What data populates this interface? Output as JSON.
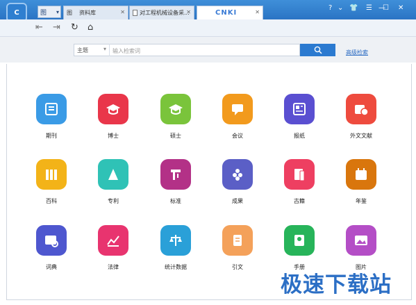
{
  "titlebar": {
    "logo_text": "C",
    "tab_selector": "图",
    "tabs": [
      {
        "label": "资料库"
      },
      {
        "label": "对工程机械设备采..."
      },
      {
        "label": "CNKI"
      }
    ],
    "controls": [
      "?",
      "⌄",
      "—",
      "☐",
      "✕"
    ]
  },
  "search": {
    "field": "主题",
    "placeholder": "输入检索词",
    "advanced": "高级检索"
  },
  "grid": [
    {
      "label": "期刊",
      "color": "#3a9be6",
      "icon": "journal-icon"
    },
    {
      "label": "博士",
      "color": "#e9364a",
      "icon": "doctor-cap-icon"
    },
    {
      "label": "硕士",
      "color": "#7ac43b",
      "icon": "master-cap-icon"
    },
    {
      "label": "会议",
      "color": "#f29a1d",
      "icon": "meeting-icon"
    },
    {
      "label": "报纸",
      "color": "#5a4fd1",
      "icon": "newspaper-icon"
    },
    {
      "label": "外文文献",
      "color": "#ee4b3e",
      "icon": "foreign-literature-icon"
    },
    {
      "label": "百科",
      "color": "#f3b318",
      "icon": "encyclopedia-icon"
    },
    {
      "label": "专利",
      "color": "#2fc2b6",
      "icon": "patent-icon"
    },
    {
      "label": "标准",
      "color": "#b33187",
      "icon": "standard-icon"
    },
    {
      "label": "成果",
      "color": "#5b5fc6",
      "icon": "achievement-icon"
    },
    {
      "label": "古籍",
      "color": "#ee3f61",
      "icon": "ancient-book-icon"
    },
    {
      "label": "年鉴",
      "color": "#d9760d",
      "icon": "yearbook-icon"
    },
    {
      "label": "词典",
      "color": "#4e57cf",
      "icon": "dictionary-icon"
    },
    {
      "label": "法律",
      "color": "#e8346f",
      "icon": "law-icon"
    },
    {
      "label": "统计数据",
      "color": "#2aa0d8",
      "icon": "statistics-icon"
    },
    {
      "label": "引文",
      "color": "#f4a15a",
      "icon": "citation-icon"
    },
    {
      "label": "手册",
      "color": "#27b45a",
      "icon": "manual-icon"
    },
    {
      "label": "图片",
      "color": "#b44ec6",
      "icon": "picture-icon"
    }
  ],
  "watermark": "极速下载站"
}
